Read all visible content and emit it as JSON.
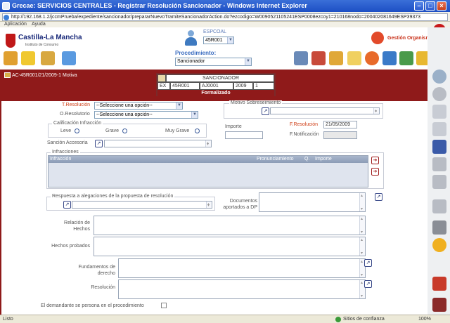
{
  "window": {
    "title": "Grecae: SERVICIOS CENTRALES - Registrar Resolución Sancionador - Windows Internet Explorer",
    "url": "http://192.168.1.2/jccmPrueba/expediente/sancionador/prepararNuevoTramiteSancionadorAction.do?ezcodigo=W0090521105241ESP0008ezcoy1=210168nodo=200402081649ESP39373"
  },
  "menu": {
    "items": [
      "Aplicación",
      "Ayuda"
    ]
  },
  "header": {
    "logo_title": "Castilla-La Mancha",
    "logo_subtitle": "Instituto de Consumo",
    "espc_label": "ESPCOAL",
    "espc_value": "45R001",
    "procedimiento_label": "Procedimiento:",
    "procedimiento_value": "Sancionador",
    "organismo_label": "Gestión Organismo"
  },
  "expediente": {
    "title": "AC-45R001/21/2009-1 Motiva",
    "box_title": "SANCIONADOR",
    "cells": [
      "EX",
      "45R001",
      "AJ0001",
      "2009",
      "1"
    ],
    "status": "Formalizado"
  },
  "form": {
    "t_resolucion_label": "T.Resolución",
    "t_resolucion_value": "--Seleccione una opción--",
    "o_resolutorio_label": "O.Resolutorio",
    "o_resolutorio_value": "--Seleccione una opción--",
    "motivo_label": "Motivo Sobreseimiento",
    "calificacion_label": "Calificación Infracción",
    "leve": "Leve",
    "grave": "Grave",
    "muy_grave": "Muy Grave",
    "importe_label": "Importe",
    "f_resolucion_label": "F.Resolución",
    "f_resolucion_value": "21/05/2009",
    "f_notificacion_label": "F.Notificación",
    "sancion_label": "Sanción Accesoria",
    "infracciones_label": "Infracciones",
    "inf_columns": [
      "Infracción",
      "Pronunciamiento",
      "Q.",
      "Importe"
    ],
    "respuesta_label": "Respuesta a alegaciones de la propuesta de resolución",
    "documentos_label": "Documentos aportados a DP",
    "relacion_label": "Relación de Hechos",
    "hechos_label": "Hechos probados",
    "fundamentos_label": "Fundamentos de derecho",
    "resolucion_label": "Resolución",
    "demandante_label": "El demandante se persona en el procedimiento"
  },
  "status": {
    "left": "Listo",
    "zone": "Sitios de confianza",
    "zoom": "100%"
  },
  "colors": {
    "titlebar": "#1d4fc4",
    "redbar": "#8f1a1a",
    "label_red": "#d04018"
  }
}
